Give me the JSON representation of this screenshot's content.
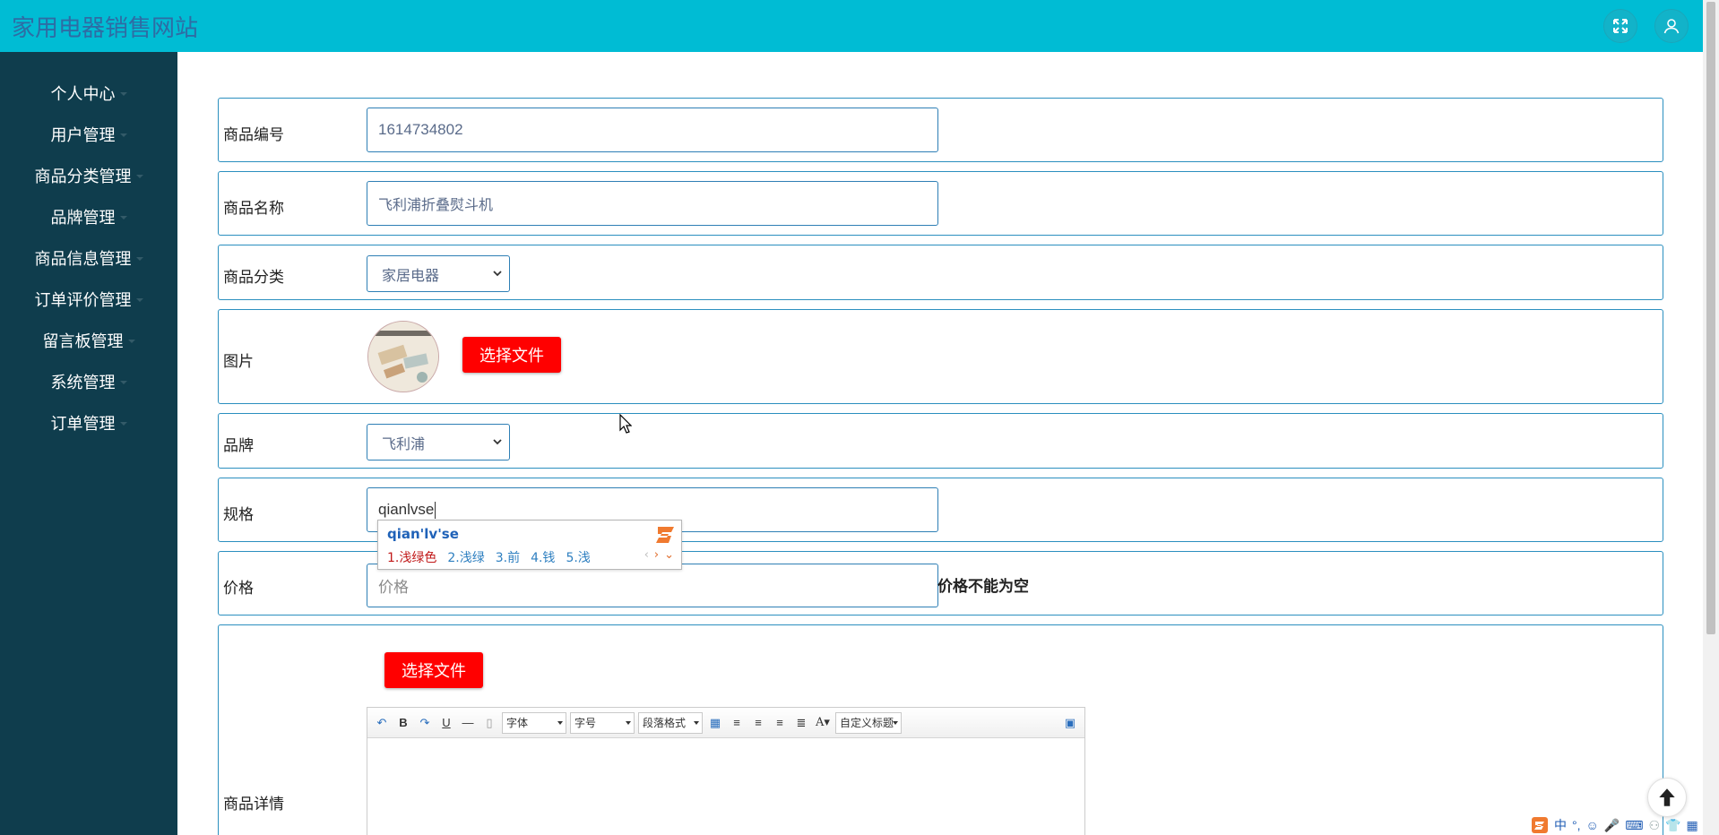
{
  "header": {
    "site_title": "家用电器销售网站"
  },
  "sidebar": {
    "items": [
      {
        "label": "个人中心"
      },
      {
        "label": "用户管理"
      },
      {
        "label": "商品分类管理"
      },
      {
        "label": "品牌管理"
      },
      {
        "label": "商品信息管理"
      },
      {
        "label": "订单评价管理"
      },
      {
        "label": "留言板管理"
      },
      {
        "label": "系统管理"
      },
      {
        "label": "订单管理"
      }
    ]
  },
  "form": {
    "product_no": {
      "label": "商品编号",
      "value": "1614734802"
    },
    "product_name": {
      "label": "商品名称",
      "value": "飞利浦折叠熨斗机"
    },
    "category": {
      "label": "商品分类",
      "selected": "家居电器"
    },
    "image": {
      "label": "图片",
      "button": "选择文件"
    },
    "brand": {
      "label": "品牌",
      "selected": "飞利浦"
    },
    "spec": {
      "label": "规格",
      "value": "qianlvse"
    },
    "price": {
      "label": "价格",
      "placeholder": "价格",
      "error": "价格不能为空"
    },
    "detail": {
      "label": "商品详情",
      "button": "选择文件",
      "toolbar": {
        "font": "字体",
        "font_size": "字号",
        "paragraph": "段落格式",
        "custom_title": "自定义标题"
      }
    }
  },
  "ime": {
    "pinyin": "qian'lv'se",
    "candidates": [
      "1.浅绿色",
      "2.浅绿",
      "3.前",
      "4.钱",
      "5.浅"
    ]
  },
  "tray": {
    "ime_mode": "中"
  }
}
